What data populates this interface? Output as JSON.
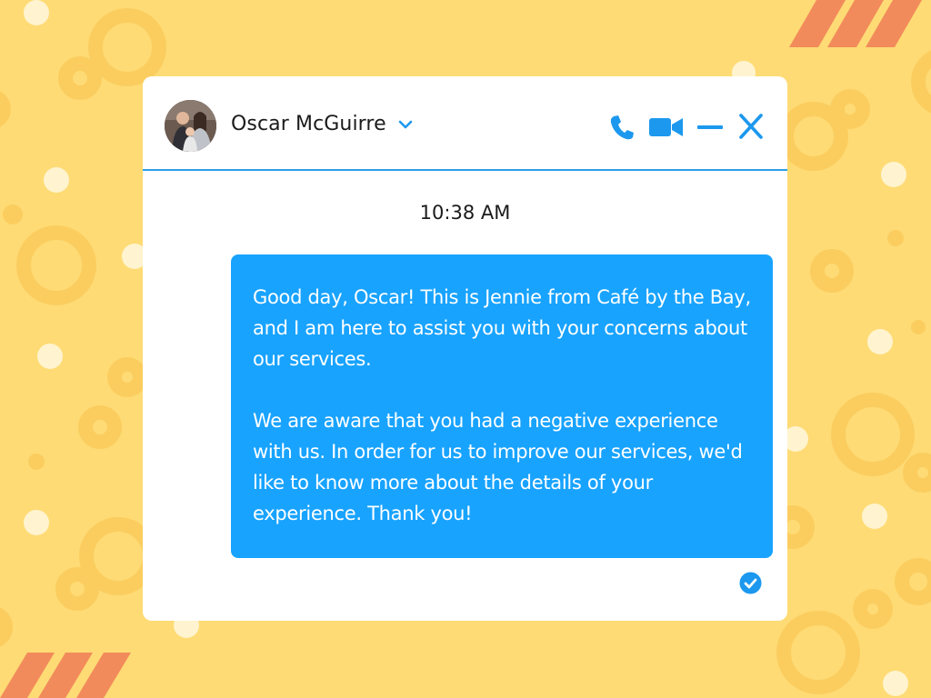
{
  "contact": {
    "name": "Oscar McGuirre",
    "avatar_icon": "family-photo-avatar"
  },
  "header_actions": [
    {
      "name": "phone-call",
      "icon": "phone-icon"
    },
    {
      "name": "video-call",
      "icon": "video-camera-icon"
    },
    {
      "name": "minimize",
      "icon": "minus-icon"
    },
    {
      "name": "close",
      "icon": "close-icon"
    }
  ],
  "conversation": {
    "timestamp": "10:38 AM",
    "message": {
      "paragraph_1": "Good day, Oscar! This is Jennie from Café by the Bay, and I am here to assist you with your concerns about our services.",
      "paragraph_2": "We are aware that you had a negative experience with us. In order for us to improve our services, we'd like to know more about the details of your experience. Thank you!",
      "status_icon": "read-checkmark-icon"
    }
  },
  "colors": {
    "background": "#FEDB75",
    "accent_blue": "#18A3FF",
    "icon_blue": "#1C98EE",
    "stripe_orange": "#F28B5B"
  }
}
